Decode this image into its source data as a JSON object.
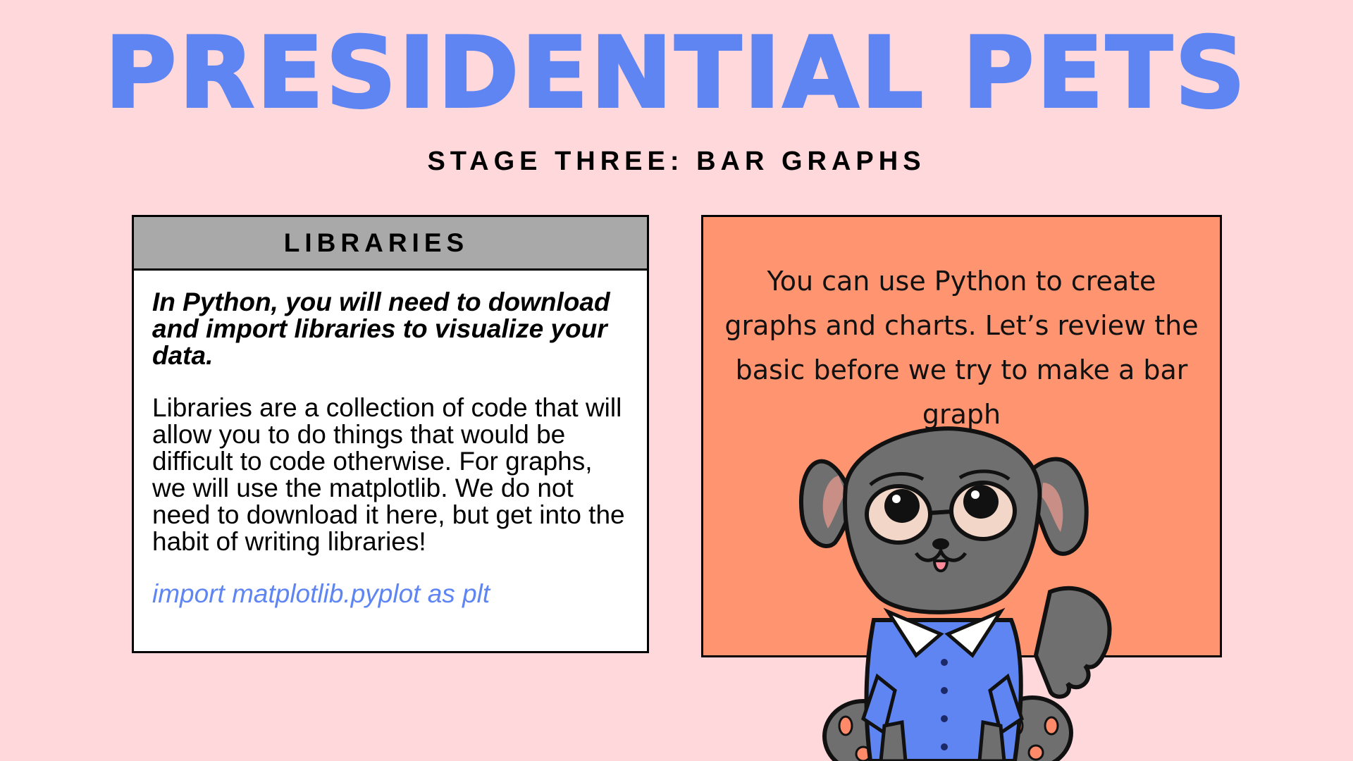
{
  "header": {
    "title": "PRESIDENTIAL PETS",
    "subtitle": "STAGE THREE: BAR GRAPHS"
  },
  "libraries_card": {
    "heading": "LIBRARIES",
    "lead": "In Python, you will need to download and import libraries to visualize your data.",
    "description": "Libraries are a collection of code that will allow you to do things that would be difficult to code otherwise. For graphs, we will use the matplotlib. We do not need to download it here, but get into the habit of writing libraries!",
    "code": "import matplotlib.pyplot as plt"
  },
  "info_card": {
    "text": "You can use Python to create graphs and charts. Let’s review the basic before we try to make a bar graph",
    "mascot": "gray-dog-with-glasses-and-blue-shirt"
  },
  "colors": {
    "background": "#ffd8dc",
    "title": "#5f85f3",
    "header_bar": "#a9a9a9",
    "info_card": "#ff9471",
    "code_text": "#5f85f3"
  }
}
